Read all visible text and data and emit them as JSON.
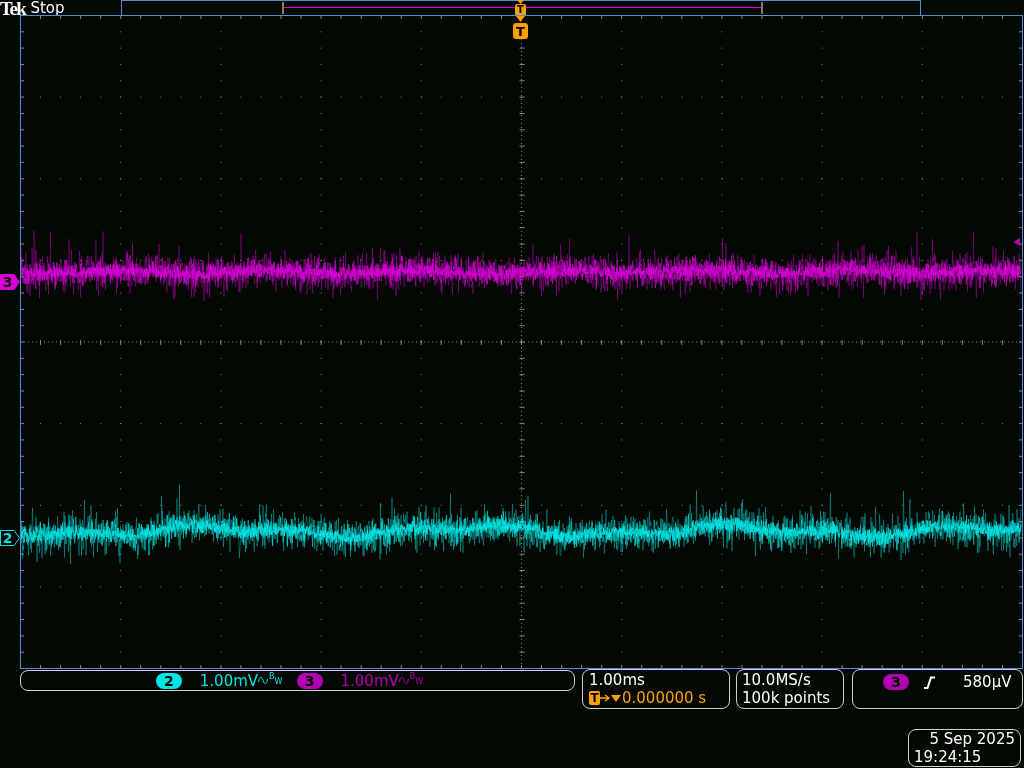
{
  "top_bar": {
    "logo": "Tek",
    "status": "Stop"
  },
  "record_view": {
    "trigger_marker": "T"
  },
  "graticule": {
    "trigger_marker": "T",
    "traces": [
      {
        "label": "3",
        "color": "#d800d8",
        "selected": true
      },
      {
        "label": "2",
        "color": "#00e6e6",
        "selected": false
      }
    ]
  },
  "readouts": {
    "channels": [
      {
        "badge": "2",
        "scale": "1.00mV",
        "bandwidth_limit": "B$_{W}$",
        "color": "#00e6e6"
      },
      {
        "badge": "3",
        "scale": "1.00mV",
        "bandwidth_limit": "B$_{W}$",
        "color": "#b000b0"
      }
    ],
    "horizontal": {
      "scale": "1.00ms",
      "trigger_marker": "T",
      "delay": "0.000000 s"
    },
    "acquisition": {
      "sample_rate": "10.0MS/s",
      "record_length": "100k points"
    },
    "trigger": {
      "source": "3",
      "color": "#b000b0",
      "level": "580µV"
    },
    "datetime": {
      "date": "5 Sep 2025",
      "time": "19:24:15"
    }
  }
}
